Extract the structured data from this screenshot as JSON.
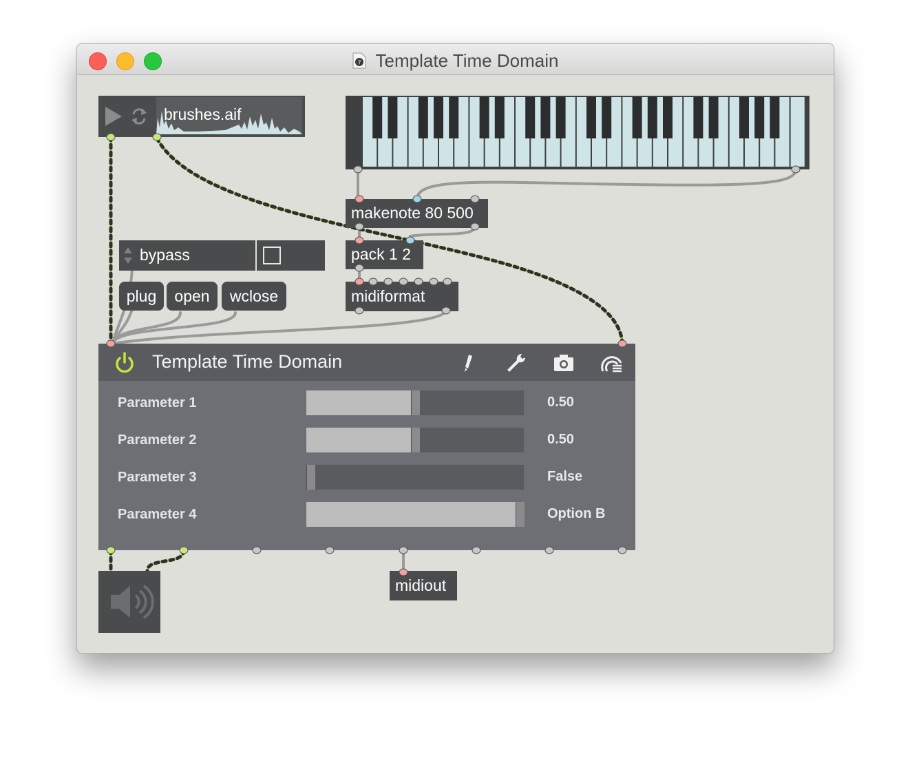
{
  "window": {
    "title": "Template Time Domain"
  },
  "playlist": {
    "file": "brushes.aif"
  },
  "bypass": {
    "label": "bypass"
  },
  "messages": [
    {
      "label": "plug"
    },
    {
      "label": "open"
    },
    {
      "label": "wclose"
    }
  ],
  "objects": {
    "makenote": "makenote 80 500",
    "pack": "pack 1 2",
    "midiformat": "midiformat",
    "midiout": "midiout"
  },
  "plugin": {
    "title": "Template Time Domain",
    "power_on": true,
    "params": [
      {
        "name": "Parameter 1",
        "value": "0.50",
        "level": 0.5
      },
      {
        "name": "Parameter 2",
        "value": "0.50",
        "level": 0.5
      },
      {
        "name": "Parameter 3",
        "value": "False",
        "level": 0.0
      },
      {
        "name": "Parameter 4",
        "value": "Option B",
        "level": 1.0
      }
    ],
    "toolbar_icons": [
      "pencil-icon",
      "wrench-icon",
      "camera-icon",
      "preset-icon"
    ]
  },
  "colors": {
    "canvas": "#dfdfd9",
    "object": "#4a4b4c",
    "plugin_body": "#6d6f75",
    "plugin_header": "#5a5b5e",
    "slider_fill": "#bcbcbc",
    "power_accent": "#c8e33a",
    "signal_cord": "#c8e878",
    "key_white": "#cfe4e6"
  }
}
